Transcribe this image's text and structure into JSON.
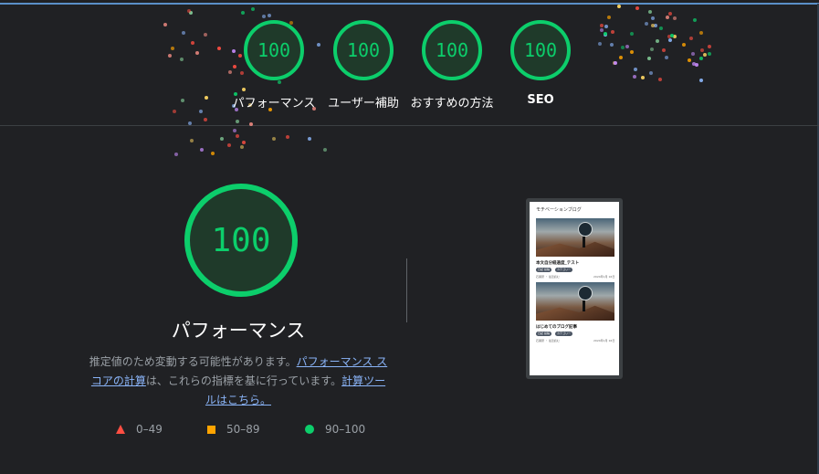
{
  "colors": {
    "background": "#202124",
    "pass_green": "#0cce6b",
    "fail_red": "#ff4e42",
    "average_orange": "#ffa400",
    "link": "#8ab4f8"
  },
  "summary_gauges": [
    {
      "score": "100",
      "label": "パフォーマンス"
    },
    {
      "score": "100",
      "label": "ユーザー補助"
    },
    {
      "score": "100",
      "label": "おすすめの方法"
    },
    {
      "score": "100",
      "label": "SEO"
    }
  ],
  "performance": {
    "score": "100",
    "title": "パフォーマンス",
    "desc_text_1": "推定値のため変動する可能性があります。",
    "desc_link_1": "パフォーマンス スコアの計算",
    "desc_text_2": "は、これらの指標を基に行っています。",
    "desc_link_2": "計算ツールはこちら。"
  },
  "legend": [
    {
      "icon": "triangle-icon",
      "label": "0–49"
    },
    {
      "icon": "square-icon",
      "label": "50–89"
    },
    {
      "icon": "circle-icon",
      "label": "90–100"
    }
  ],
  "screenshot": {
    "blog_title": "モチベーションブログ",
    "posts": [
      {
        "title": "本文自分経過度_テスト",
        "tags": [
          "日記 投稿",
          "カテゴリー"
        ],
        "author": "石黒研 ・ 最近読む",
        "date": "2024年1月 16日"
      },
      {
        "title": "はじめてのブログ記事",
        "tags": [
          "日記 投稿",
          "カテゴリー"
        ],
        "author": "石黒研 ・ 最近読む",
        "date": "2024年1月 16日"
      }
    ]
  }
}
